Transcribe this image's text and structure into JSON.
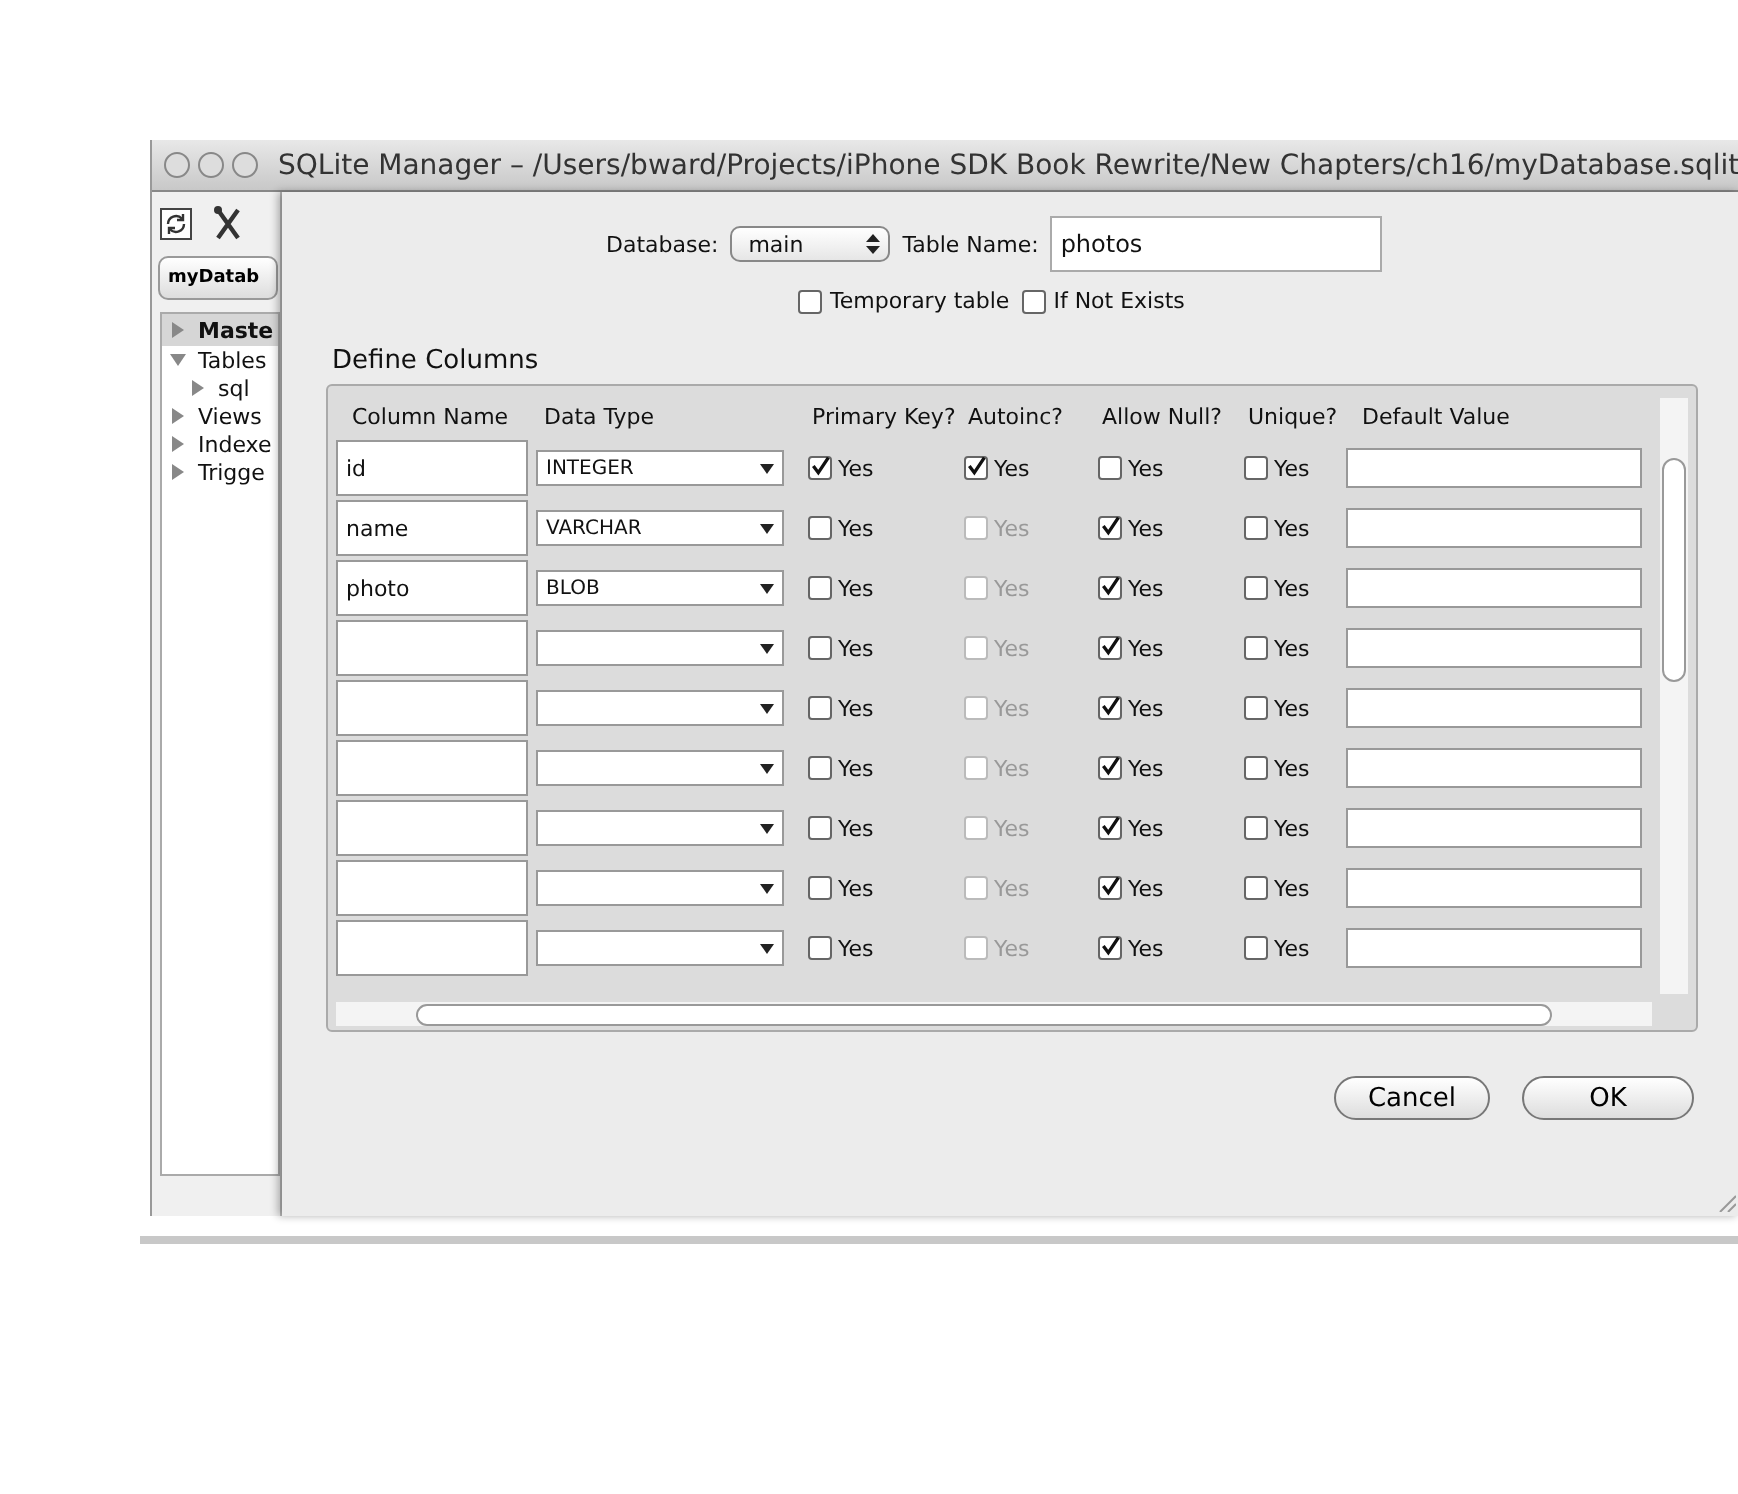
{
  "window": {
    "title": "SQLite Manager – /Users/bward/Projects/iPhone SDK Book Rewrite/New Chapters/ch16/myDatabase.sqlit"
  },
  "sidebar": {
    "database_button": "myDatab",
    "items": [
      {
        "label": "Maste",
        "expanded": false,
        "selected": true
      },
      {
        "label": "Tables",
        "expanded": true,
        "selected": false,
        "children": [
          {
            "label": "sql",
            "expanded": false,
            "selected": false
          }
        ]
      },
      {
        "label": "Views",
        "expanded": false,
        "selected": false
      },
      {
        "label": "Indexe",
        "expanded": false,
        "selected": false
      },
      {
        "label": "Trigge",
        "expanded": false,
        "selected": false
      }
    ]
  },
  "form": {
    "database_label": "Database:",
    "database_value": "main",
    "table_name_label": "Table Name:",
    "table_name_value": "photos",
    "options": [
      {
        "label": "Temporary table",
        "checked": false
      },
      {
        "label": "If Not Exists",
        "checked": false
      }
    ]
  },
  "define_columns": {
    "title": "Define Columns",
    "headers": [
      "Column Name",
      "Data Type",
      "Primary Key?",
      "Autoinc?",
      "Allow Null?",
      "Unique?",
      "Default Value"
    ],
    "rows": [
      {
        "name": "id",
        "type": "INTEGER",
        "primary_key": {
          "label": "Yes",
          "checked": true,
          "disabled": false
        },
        "autoinc": {
          "label": "Yes",
          "checked": true,
          "disabled": false
        },
        "allow_null": {
          "label": "Yes",
          "checked": false,
          "disabled": false
        },
        "unique": {
          "label": "Yes",
          "checked": false,
          "disabled": false
        }
      },
      {
        "name": "name",
        "type": "VARCHAR",
        "primary_key": {
          "label": "Yes",
          "checked": false,
          "disabled": false
        },
        "autoinc": {
          "label": "Yes",
          "checked": false,
          "disabled": true
        },
        "allow_null": {
          "label": "Yes",
          "checked": true,
          "disabled": false
        },
        "unique": {
          "label": "Yes",
          "checked": false,
          "disabled": false
        }
      },
      {
        "name": "photo",
        "type": "BLOB",
        "primary_key": {
          "label": "Yes",
          "checked": false,
          "disabled": false
        },
        "autoinc": {
          "label": "Yes",
          "checked": false,
          "disabled": true
        },
        "allow_null": {
          "label": "Yes",
          "checked": true,
          "disabled": false
        },
        "unique": {
          "label": "Yes",
          "checked": false,
          "disabled": false
        }
      },
      {
        "primary_key": {
          "label": "Yes",
          "checked": false,
          "disabled": false
        },
        "autoinc": {
          "label": "Yes",
          "checked": false,
          "disabled": true
        },
        "allow_null": {
          "label": "Yes",
          "checked": true,
          "disabled": false
        },
        "unique": {
          "label": "Yes",
          "checked": false,
          "disabled": false
        }
      },
      {
        "primary_key": {
          "label": "Yes",
          "checked": false,
          "disabled": false
        },
        "autoinc": {
          "label": "Yes",
          "checked": false,
          "disabled": true
        },
        "allow_null": {
          "label": "Yes",
          "checked": true,
          "disabled": false
        },
        "unique": {
          "label": "Yes",
          "checked": false,
          "disabled": false
        }
      },
      {
        "primary_key": {
          "label": "Yes",
          "checked": false,
          "disabled": false
        },
        "autoinc": {
          "label": "Yes",
          "checked": false,
          "disabled": true
        },
        "allow_null": {
          "label": "Yes",
          "checked": true,
          "disabled": false
        },
        "unique": {
          "label": "Yes",
          "checked": false,
          "disabled": false
        }
      },
      {
        "primary_key": {
          "label": "Yes",
          "checked": false,
          "disabled": false
        },
        "autoinc": {
          "label": "Yes",
          "checked": false,
          "disabled": true
        },
        "allow_null": {
          "label": "Yes",
          "checked": true,
          "disabled": false
        },
        "unique": {
          "label": "Yes",
          "checked": false,
          "disabled": false
        }
      },
      {
        "primary_key": {
          "label": "Yes",
          "checked": false,
          "disabled": false
        },
        "autoinc": {
          "label": "Yes",
          "checked": false,
          "disabled": true
        },
        "allow_null": {
          "label": "Yes",
          "checked": true,
          "disabled": false
        },
        "unique": {
          "label": "Yes",
          "checked": false,
          "disabled": false
        }
      },
      {
        "primary_key": {
          "label": "Yes",
          "checked": false,
          "disabled": false
        },
        "autoinc": {
          "label": "Yes",
          "checked": false,
          "disabled": true
        },
        "allow_null": {
          "label": "Yes",
          "checked": true,
          "disabled": false
        },
        "unique": {
          "label": "Yes",
          "checked": false,
          "disabled": false
        }
      }
    ]
  },
  "buttons": [
    "Cancel",
    "OK"
  ]
}
